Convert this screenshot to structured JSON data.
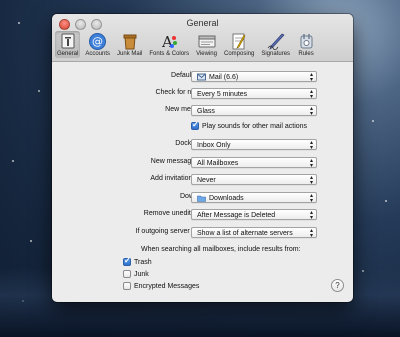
{
  "window": {
    "title": "General"
  },
  "toolbar": [
    {
      "label": "General",
      "icon": "general-icon",
      "selected": true
    },
    {
      "label": "Accounts",
      "icon": "accounts-icon"
    },
    {
      "label": "Junk Mail",
      "icon": "junk-mail-icon"
    },
    {
      "label": "Fonts & Colors",
      "icon": "fonts-colors-icon"
    },
    {
      "label": "Viewing",
      "icon": "viewing-icon"
    },
    {
      "label": "Composing",
      "icon": "composing-icon"
    },
    {
      "label": "Signatures",
      "icon": "signatures-icon"
    },
    {
      "label": "Rules",
      "icon": "rules-icon"
    }
  ],
  "settings": {
    "default_email_reader": {
      "label": "Default email reader:",
      "value": "Mail (6.6)"
    },
    "check_new_messages": {
      "label": "Check for new messages:",
      "value": "Every 5 minutes"
    },
    "new_messages_sound": {
      "label": "New messages sound:",
      "value": "Glass"
    },
    "play_sounds": {
      "label": "Play sounds for other mail actions",
      "checked": true
    },
    "dock_unread_count": {
      "label": "Dock unread count:",
      "value": "Inbox Only"
    },
    "new_message_notifications": {
      "label": "New message notifications:",
      "value": "All Mailboxes"
    },
    "add_invitations": {
      "label": "Add invitations to Calendar:",
      "value": "Never"
    },
    "downloads_folder": {
      "label": "Downloads folder:",
      "value": "Downloads"
    },
    "remove_unedited_downloads": {
      "label": "Remove unedited downloads:",
      "value": "After Message is Deleted"
    },
    "outgoing_server_unavailable": {
      "label": "If outgoing server is unavailable:",
      "value": "Show a list of alternate servers"
    }
  },
  "search": {
    "heading": "When searching all mailboxes, include results from:",
    "options": [
      {
        "label": "Trash",
        "checked": true
      },
      {
        "label": "Junk",
        "checked": false
      },
      {
        "label": "Encrypted Messages",
        "checked": false
      }
    ]
  },
  "help": {
    "label": "?"
  }
}
